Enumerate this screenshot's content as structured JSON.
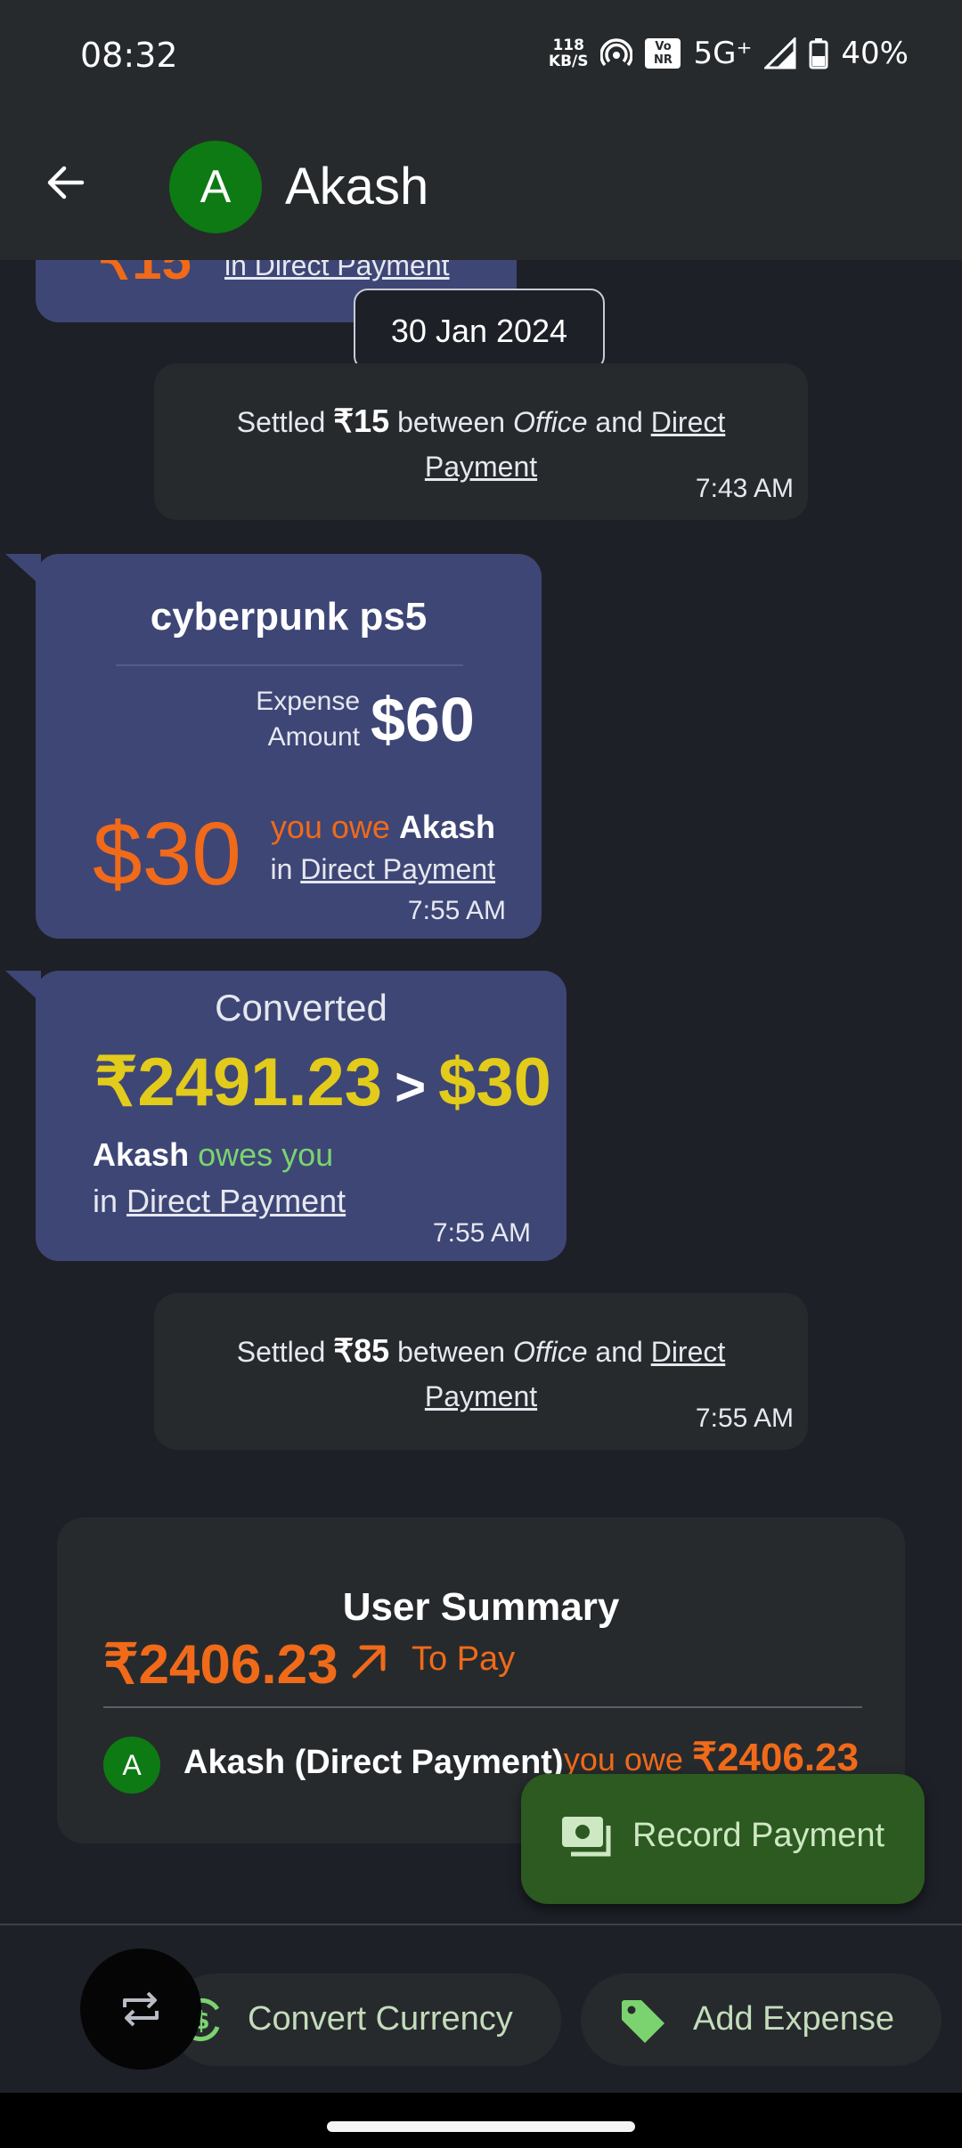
{
  "status_bar": {
    "time": "08:32",
    "net_speed_value": "118",
    "net_speed_unit": "KB/S",
    "volte_top": "Vo",
    "volte_bottom": "NR",
    "network": "5G⁺",
    "battery": "40%"
  },
  "header": {
    "avatar_letter": "A",
    "title": "Akash"
  },
  "chat": {
    "partial_bubble": {
      "amount": "₹15",
      "in_text": "in Direct Payment"
    },
    "date_chip": "30 Jan 2024",
    "settlements": [
      {
        "prefix": "Settled",
        "amount": "₹15",
        "between": "between",
        "from": "Office",
        "and": "and",
        "to": "Direct Payment",
        "time": "7:43 AM"
      },
      {
        "prefix": "Settled",
        "amount": "₹85",
        "between": "between",
        "from": "Office",
        "and": "and",
        "to": "Direct Payment",
        "time": "7:55 AM"
      }
    ],
    "expense": {
      "title": "cyberpunk ps5",
      "amount_label_1": "Expense",
      "amount_label_2": "Amount",
      "amount": "$60",
      "share": "$30",
      "owe_text": "you owe",
      "person": "Akash",
      "in_word": "in",
      "group": "Direct Payment",
      "time": "7:55 AM"
    },
    "conversion": {
      "header": "Converted",
      "from_amount": "₹2491.23",
      "arrow": ">",
      "to_amount": "$30",
      "person": "Akash",
      "owes_text": "owes you",
      "in_word": "in",
      "group": "Direct Payment",
      "time": "7:55 AM"
    }
  },
  "summary": {
    "title": "User Summary",
    "total": "₹2406.23",
    "direction": "To Pay",
    "row": {
      "avatar_letter": "A",
      "name": "Akash (Direct Payment)",
      "owe_text": "you owe",
      "amount": "₹2406.23"
    }
  },
  "fab": {
    "label": "Record Payment",
    "icon": "cash-icon"
  },
  "bottom_actions": {
    "convert_label": "Convert Currency",
    "add_label": "Add Expense"
  },
  "colors": {
    "bubble": "#3e4676",
    "owe_orange": "#f06a1a",
    "owes_green": "#7bd36f",
    "converted_yellow": "#e2cb1b",
    "fab_green": "#2c5a20",
    "avatar_green": "#0e7a13"
  }
}
